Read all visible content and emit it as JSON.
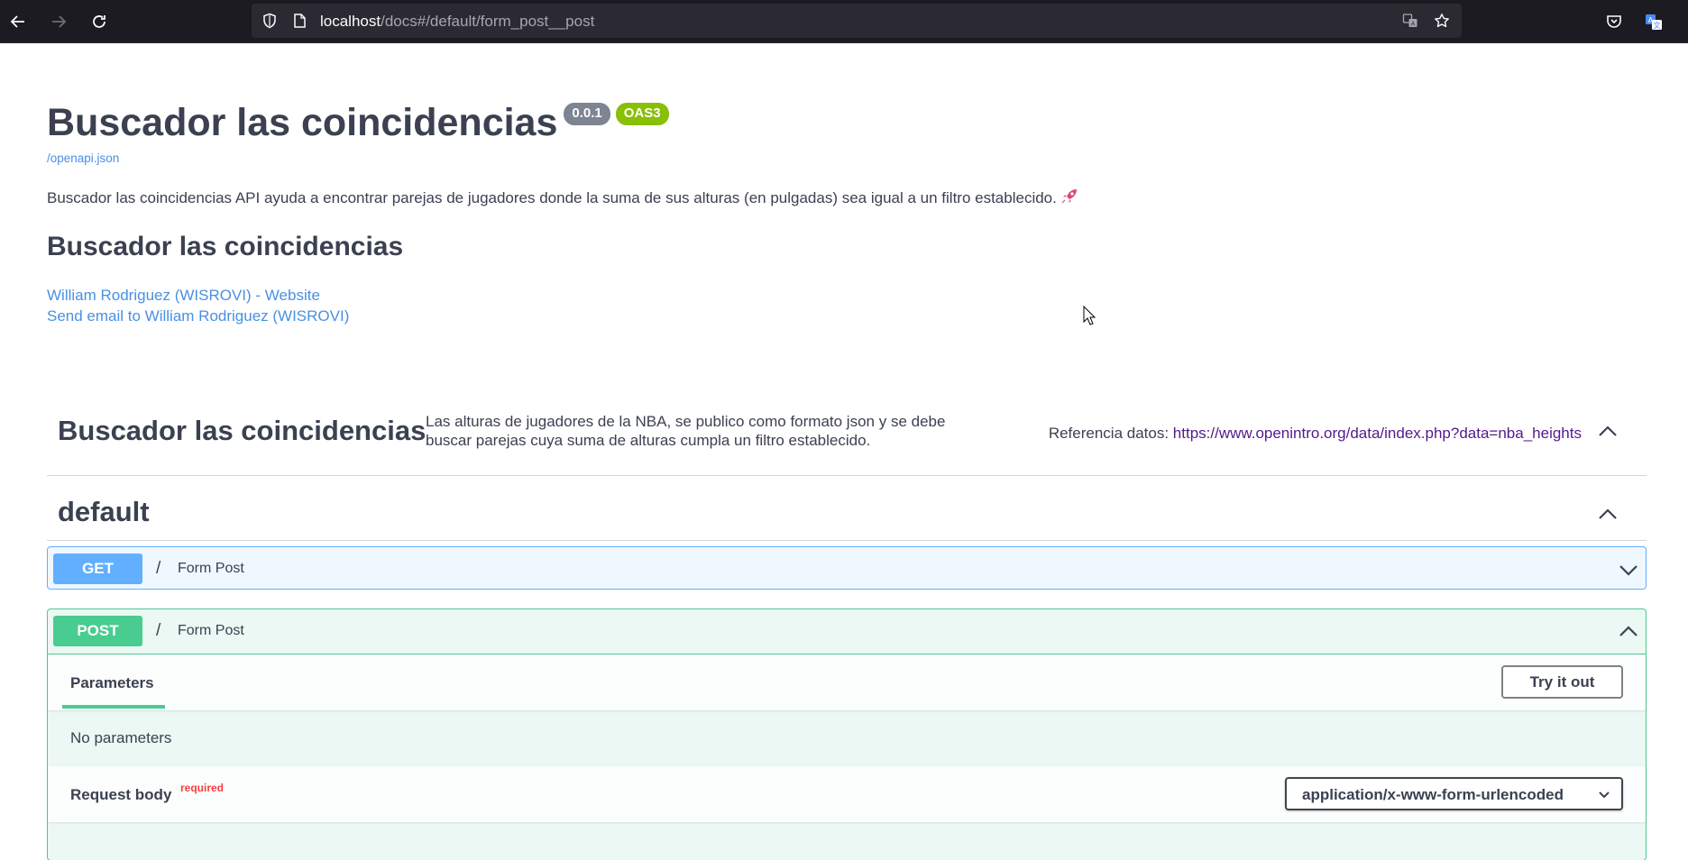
{
  "browser": {
    "url_host": "localhost",
    "url_path": "/docs#/default/form_post__post"
  },
  "info": {
    "title": "Buscador las coincidencias",
    "version": "0.0.1",
    "oas": "OAS3",
    "spec_link": "/openapi.json",
    "description": "Buscador las coincidencias API ayuda a encontrar parejas de jugadores donde la suma de sus alturas (en pulgadas) sea igual a un filtro establecido.",
    "heading": "Buscador las coincidencias",
    "contact_website": "William Rodriguez (WISROVI) - Website",
    "contact_email": "Send email to William Rodriguez (WISROVI)"
  },
  "tags": {
    "main": {
      "name": "Buscador las coincidencias",
      "description": "Las alturas de jugadores de la NBA, se publico como formato json y se debe buscar parejas cuya suma de alturas cumpla un filtro establecido.",
      "ext_label": "Referencia datos:",
      "ext_link": "https://www.openintro.org/data/index.php?data=nba_heights"
    },
    "default": {
      "name": "default"
    }
  },
  "operations": {
    "get": {
      "method": "GET",
      "path": "/",
      "summary": "Form Post"
    },
    "post": {
      "method": "POST",
      "path": "/",
      "summary": "Form Post",
      "params_tab": "Parameters",
      "try_button": "Try it out",
      "no_params": "No parameters",
      "request_body": "Request body",
      "required": "required",
      "content_type": "application/x-www-form-urlencoded"
    }
  },
  "colors": {
    "get": "#61affe",
    "post": "#49cc90",
    "link": "#4990e2",
    "version_badge": "#7d8492",
    "oas_badge": "#89bf04"
  }
}
